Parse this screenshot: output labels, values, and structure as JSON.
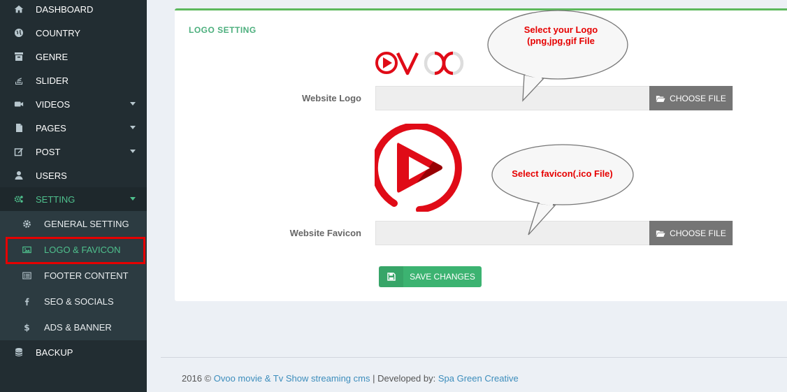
{
  "sidebar": {
    "items": [
      {
        "label": "DASHBOARD",
        "icon": "home-icon"
      },
      {
        "label": "COUNTRY",
        "icon": "globe-icon"
      },
      {
        "label": "GENRE",
        "icon": "archive-icon"
      },
      {
        "label": "SLIDER",
        "icon": "stack-icon"
      },
      {
        "label": "VIDEOS",
        "icon": "video-camera-icon"
      },
      {
        "label": "PAGES",
        "icon": "file-icon"
      },
      {
        "label": "POST",
        "icon": "edit-icon"
      },
      {
        "label": "USERS",
        "icon": "user-icon"
      },
      {
        "label": "SETTING",
        "icon": "gears-icon"
      }
    ],
    "sub_items": [
      {
        "label": "GENERAL SETTING",
        "icon": "cog-icon"
      },
      {
        "label": "LOGO & FAVICON",
        "icon": "image-icon"
      },
      {
        "label": "FOOTER CONTENT",
        "icon": "list-alt-icon"
      },
      {
        "label": "SEO & SOCIALS",
        "icon": "facebook-icon"
      },
      {
        "label": "ADS & BANNER",
        "icon": "dollar-icon"
      }
    ],
    "backup": {
      "label": "BACKUP",
      "icon": "database-icon"
    }
  },
  "panel": {
    "title": "LOGO SETTING",
    "logo_label": "Website Logo",
    "favicon_label": "Website Favicon",
    "choose_file": "CHOOSE FILE",
    "save": "SAVE CHANGES"
  },
  "bubbles": {
    "logo_line1": "Select your Logo",
    "logo_line2": "(png,jpg,gif File",
    "favicon": "Select favicon(.ico File)"
  },
  "footer": {
    "year": "2016 ©",
    "product": "Ovoo movie & Tv Show streaming cms",
    "separator": "| Developed by:",
    "developer": "Spa Green Creative"
  },
  "colors": {
    "sidebar_bg": "#222d32",
    "accent_green": "#4fc08d",
    "brand_red": "#e00b17",
    "annotation_red": "#e60000"
  }
}
